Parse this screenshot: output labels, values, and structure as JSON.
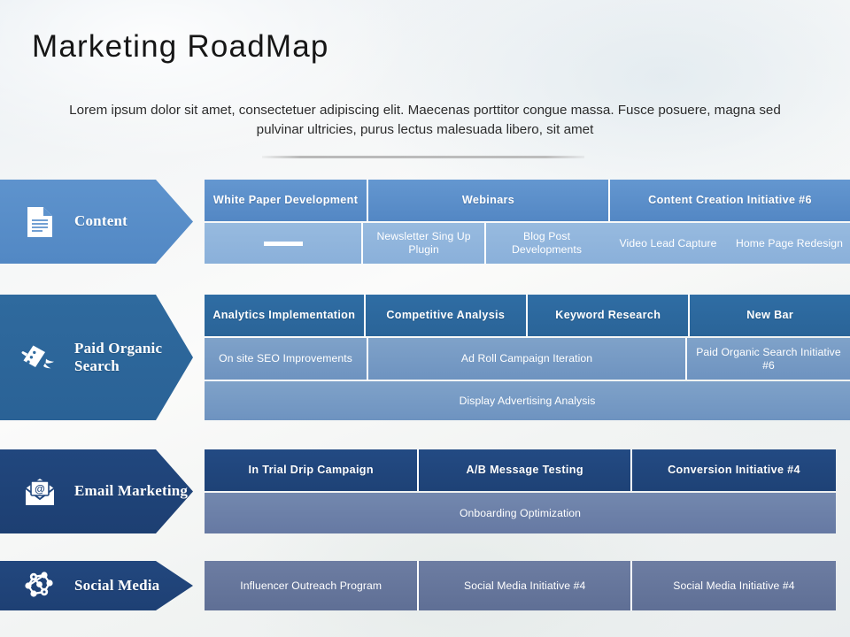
{
  "slide": {
    "title": "Marketing  RoadMap",
    "subtitle": "Lorem ipsum dolor sit amet, consectetuer adipiscing elit. Maecenas porttitor congue massa. Fusce posuere, magna sed pulvinar ultricies, purus lectus malesuada libero, sit amet"
  },
  "rows": [
    {
      "key": "content",
      "label": "Content",
      "icon": "document-icon",
      "arrow_color": "#5e93cd",
      "header_color": "#6497d0",
      "sub_color": "#97badf",
      "lines": [
        {
          "cells": [
            {
              "text": "White Paper Development",
              "flex": 181
            },
            {
              "text": "Webinars",
              "flex": 274
            },
            {
              "text": "Content Creation Initiative  #6",
              "flex": 274
            }
          ]
        },
        {
          "cells": [
            {
              "text": "",
              "flex": 181,
              "dash": true
            },
            {
              "text": "Newsletter Sing Up Plugin",
              "flex": 137
            },
            {
              "text": "Blog Post Developments",
              "flex": 137
            },
            {
              "text": "Video Lead Capture",
              "flex": 137
            },
            {
              "text": "Home Page Redesign",
              "flex": 137,
              "nosep": true
            }
          ]
        }
      ]
    },
    {
      "key": "paid",
      "label": "Paid Organic Search",
      "icon": "winged-ticket-icon",
      "arrow_color": "#2f6a9e",
      "header_color": "#2f6da4",
      "sub_color": "#7fa2c9",
      "lines": [
        {
          "cells": [
            {
              "text": "Analytics Implementation",
              "flex": 181
            },
            {
              "text": "Competitive Analysis",
              "flex": 183
            },
            {
              "text": "Keyword Research",
              "flex": 183
            },
            {
              "text": "New  Bar",
              "flex": 182
            }
          ]
        },
        {
          "cells": [
            {
              "text": "On site SEO Improvements",
              "flex": 181
            },
            {
              "text": "Ad Roll Campaign Iteration",
              "flex": 366
            },
            {
              "text": "Paid Organic Search Initiative #6",
              "flex": 182
            }
          ]
        },
        {
          "cells": [
            {
              "text": "Display Advertising Analysis",
              "flex": 729,
              "nosep": true
            }
          ]
        }
      ]
    },
    {
      "key": "email",
      "label": "Email Marketing",
      "icon": "envelope-at-icon",
      "arrow_color": "#21477e",
      "header_color": "#234a83",
      "sub_color": "#7388ae",
      "lines": [
        {
          "cells": [
            {
              "text": "In Trial Drip Campaign",
              "flex": 242
            },
            {
              "text": "A/B Message Testing",
              "flex": 240
            },
            {
              "text": "Conversion Initiative #4",
              "flex": 231
            }
          ]
        },
        {
          "cells": [
            {
              "text": "Onboarding Optimization",
              "flex": 713,
              "nosep": true
            }
          ]
        }
      ]
    },
    {
      "key": "social",
      "label": "Social Media",
      "icon": "network-nodes-icon",
      "arrow_color": "#22477e",
      "header_color": "#6d7da2",
      "sub_color": "#6d7da2",
      "lines": [
        {
          "cells": [
            {
              "text": "Influencer Outreach Program",
              "flex": 242
            },
            {
              "text": "Social Media Initiative #4",
              "flex": 240
            },
            {
              "text": "Social Media Initiative #4",
              "flex": 231
            }
          ]
        }
      ]
    }
  ]
}
